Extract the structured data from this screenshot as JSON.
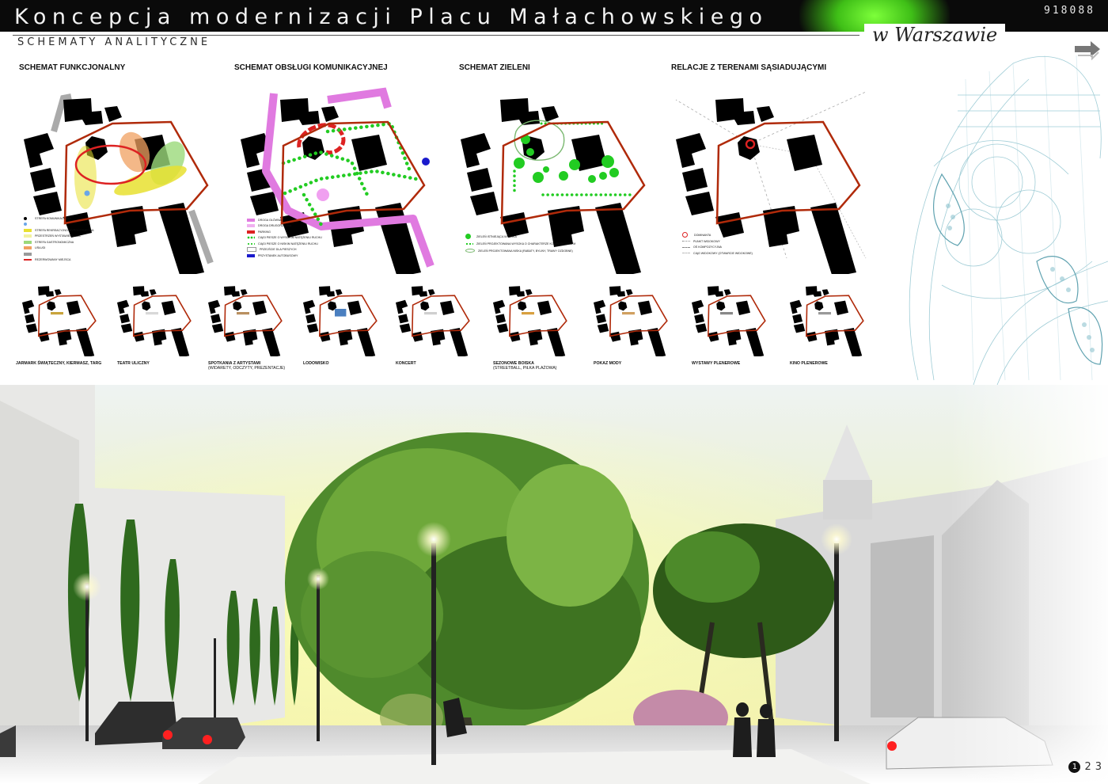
{
  "header": {
    "title": "Koncepcja modernizacji Placu Małachowskiego",
    "project_number": "918088",
    "subtitle": "SCHEMATY ANALITYCZNE",
    "city": "w Warszawie"
  },
  "colors": {
    "header_bg": "#0a0a0a",
    "header_glow": "#7dff3a",
    "plaza_outline": "#b02a0a",
    "buildings": "#000000",
    "road_pink": "#e07ae0",
    "path_green": "#22cc22",
    "bus_stop_blue": "#1a1acc",
    "sketch_blue": "#8fc4cf"
  },
  "schemes": [
    {
      "title": "SCHEMAT FUNKCJONALNY",
      "legend": [
        {
          "color": "#000000",
          "label": "STREFA KOMUNIKACYJNA",
          "shape": "dot"
        },
        {
          "color": "#6aa6e8",
          "label": "",
          "shape": "dot"
        },
        {
          "color": "#e8e030",
          "label": "STREFA REKREACYJNO-WYPOCZYNKOWA",
          "shape": "bar"
        },
        {
          "color": "#f2f2a0",
          "label": "PRZESTRZEŃ WYSTAWIENNICZA",
          "shape": "bar"
        },
        {
          "color": "#9bd97a",
          "label": "STREFA GASTRONOMICZNA",
          "shape": "bar"
        },
        {
          "color": "#f0a060",
          "label": "USŁUGI",
          "shape": "bar"
        },
        {
          "color": "#9a9a9a",
          "label": "",
          "shape": "bar"
        },
        {
          "color": "#dd2222",
          "label": "REZERWOWANY MIEJSCA",
          "shape": "bar"
        }
      ]
    },
    {
      "title": "SCHEMAT OBSŁUGI KOMUNIKACYJNEJ",
      "legend": [
        {
          "color": "#e07ae0",
          "label": "DROGA GŁÓWNA",
          "shape": "bar"
        },
        {
          "color": "#f0b0f0",
          "label": "DROGA DRUGORZĘDNA",
          "shape": "bar"
        },
        {
          "color": "#dd2222",
          "label": "PARKING",
          "shape": "bar"
        },
        {
          "color": "#22cc22",
          "label": "CIĄGI PIESZE O WYSOKIM NATĘŻENIU RUCHU",
          "shape": "dots"
        },
        {
          "color": "#22cc22",
          "label": "CIĄGI PIESZE O NISKIM NATĘŻENIU RUCHU",
          "shape": "dots"
        },
        {
          "color": "#ffffff",
          "label": "PRZEJŚCIE DLA PIESZYCH",
          "shape": "bar"
        },
        {
          "color": "#1a1acc",
          "label": "PRZYSTANEK AUTOBUSOWY",
          "shape": "bar"
        }
      ]
    },
    {
      "title": "SCHEMAT ZIELENI",
      "legend": [
        {
          "color": "#22cc22",
          "label": "ZIELEŃ ISTNIEJĄCA WYSOKA",
          "shape": "dot"
        },
        {
          "color": "#22cc22",
          "label": "ZIELEŃ PROJEKTOWANA WYSOKA O CHARAKTERZE KOMPOZYCYJNYM",
          "shape": "dots"
        },
        {
          "color": "#7ab870",
          "label": "ZIELEŃ PROJEKTOWANA NISKA (RABATY, BYLINY, TRAWY OZDOBNE)",
          "shape": "ring"
        }
      ]
    },
    {
      "title": "RELACJE Z TERENAMI SĄSIADUJĄCYMI",
      "legend": [
        {
          "color": "#dd2222",
          "label": "DOMINANTA",
          "shape": "ring"
        },
        {
          "color": "#888888",
          "label": "PUNKT WIDOKOWY",
          "shape": "bar"
        },
        {
          "color": "#888888",
          "label": "OŚ KOMPOZYCYJNA",
          "shape": "bar"
        },
        {
          "color": "#888888",
          "label": "CIĄG WIDOKOWY (OTWARCIE WIDOKOWE)",
          "shape": "bar"
        }
      ]
    }
  ],
  "events": [
    {
      "label": "JARMARK ŚWIĄTECZNY, KIERMASZ, TARG",
      "sub": ""
    },
    {
      "label": "TEATR ULICZNY",
      "sub": ""
    },
    {
      "label": "SPOTKANIA Z ARTYSTAMI",
      "sub": "(WIDARETY, ODCZYTY, PREZENTACJE)"
    },
    {
      "label": "LODOWISKO",
      "sub": ""
    },
    {
      "label": "KONCERT",
      "sub": ""
    },
    {
      "label": "SEZONOWE BOISKA",
      "sub": "(STREETBALL, PIŁKA PLAŻOWA)"
    },
    {
      "label": "POKAZ MODY",
      "sub": ""
    },
    {
      "label": "WYSTAWY PLENEROWE",
      "sub": ""
    },
    {
      "label": "KINO PLENEROWE",
      "sub": ""
    }
  ],
  "pages": {
    "current": "1",
    "others": [
      "2",
      "3"
    ]
  }
}
